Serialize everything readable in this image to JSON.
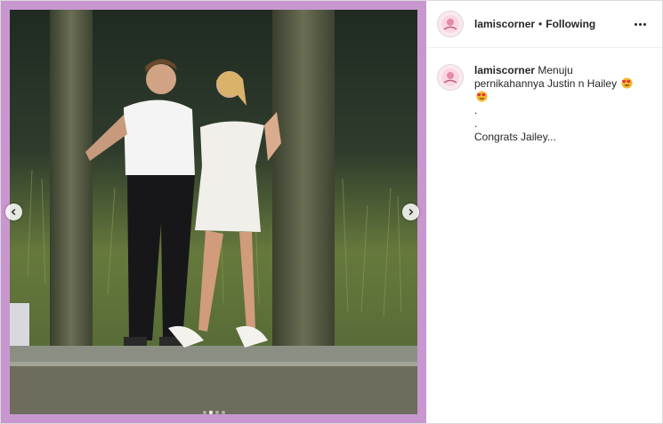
{
  "post": {
    "account": {
      "username": "lamiscorner",
      "separator": "•",
      "follow_status": "Following"
    },
    "caption": {
      "username": "lamiscorner",
      "text_line1": "Menuju pernikahannya Justin n Hailey",
      "emojis": [
        "heart-eyes-emoji",
        "heart-eyes-emoji"
      ],
      "dot_line1": ".",
      "dot_line2": ".",
      "text_line2": "Congrats Jailey..."
    },
    "carousel": {
      "total_slides": 4,
      "active_index": 1
    },
    "colors": {
      "frame": "#c897cf",
      "text": "#262626",
      "divider": "#efefef"
    }
  }
}
